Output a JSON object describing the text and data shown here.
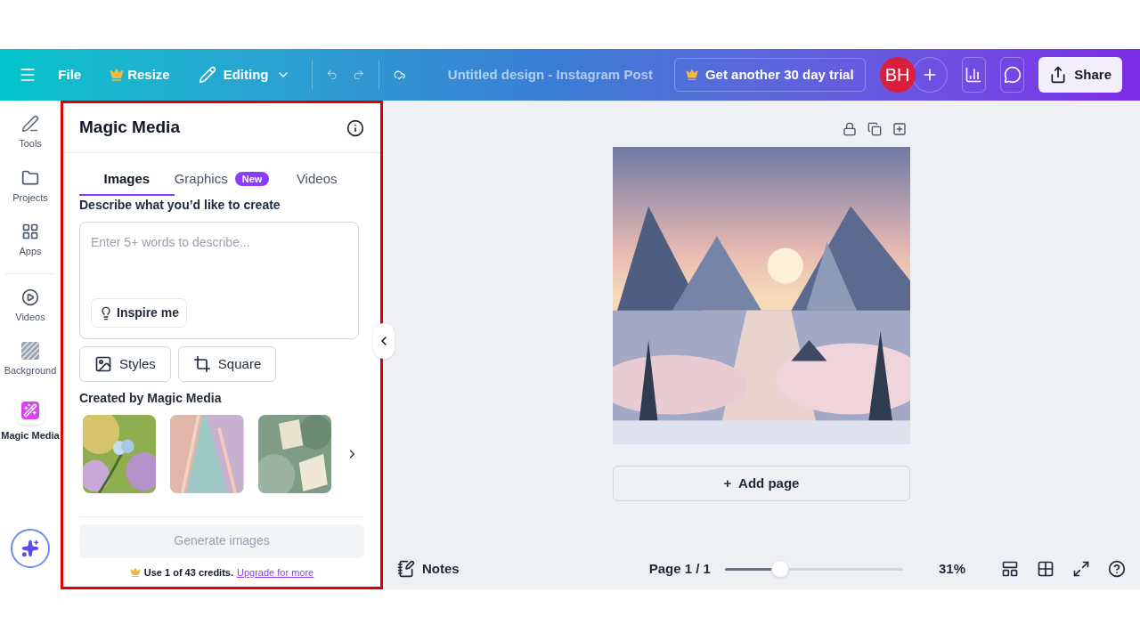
{
  "header": {
    "menu": "File",
    "resize": "Resize",
    "mode": "Editing",
    "title": "Untitled design - Instagram Post",
    "trial": "Get another 30 day trial",
    "avatar": "BH",
    "share": "Share"
  },
  "sidebar": {
    "items": [
      {
        "label": "Tools",
        "selected": false
      },
      {
        "label": "Projects",
        "selected": false
      },
      {
        "label": "Apps",
        "selected": false
      },
      {
        "label": "Videos",
        "selected": false
      },
      {
        "label": "Background",
        "selected": false
      },
      {
        "label": "Magic Media",
        "selected": true
      }
    ]
  },
  "panel": {
    "title": "Magic Media",
    "tabs": [
      {
        "label": "Images",
        "selected": true
      },
      {
        "label": "Graphics",
        "badge": "New",
        "selected": false
      },
      {
        "label": "Videos",
        "selected": false
      }
    ],
    "prompt_label": "Describe what you’d like to create",
    "prompt": {
      "placeholder": "Enter 5+ words to describe..."
    },
    "inspire": "Inspire me",
    "styles": "Styles",
    "ratio": "Square",
    "gallery_title": "Created by Magic Media",
    "generate": {
      "label": "Generate images",
      "disabled": true
    },
    "credits": "Use 1 of 43 credits.",
    "upgrade": "Upgrade for more"
  },
  "canvas": {
    "add_page": "+  Add page"
  },
  "footer": {
    "notes": "Notes",
    "page": "Page 1 / 1",
    "zoom": {
      "level": 0.31
    },
    "zoom_reading": "31%"
  }
}
